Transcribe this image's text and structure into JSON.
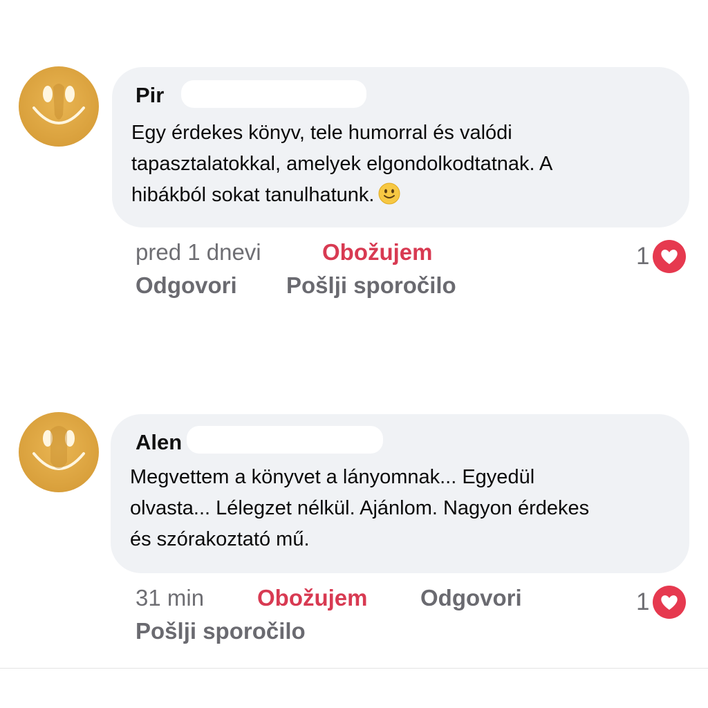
{
  "comments": [
    {
      "author": "Pir",
      "text_lines": [
        "Egy érdekes könyv, tele humorral és valódi",
        "tapasztalatokkal, amelyek elgondolkodtatnak. A",
        "hibákból sokat tanulhatunk."
      ],
      "emoji": "slightly-smiling-face-icon",
      "time": "pred 1 dnevi",
      "like_label": "Obožujem",
      "reply_label": "Odgovori",
      "message_label": "Pošlji sporočilo",
      "like_count": "1"
    },
    {
      "author": "Alen",
      "text_lines": [
        "Megvettem a könyvet a lányomnak... Egyedül",
        "olvasta... Lélegzet nélkül. Ajánlom. Nagyon érdekes",
        "és szórakoztató mű."
      ],
      "time": "31 min",
      "like_label": "Obožujem",
      "reply_label": "Odgovori",
      "message_label": "Pošlji sporočilo",
      "like_count": "1"
    }
  ],
  "colors": {
    "bubble": "#f0f2f5",
    "like_accent": "#d83a52",
    "meta_text": "#6e6e73",
    "avatar": "#d9a03c"
  }
}
